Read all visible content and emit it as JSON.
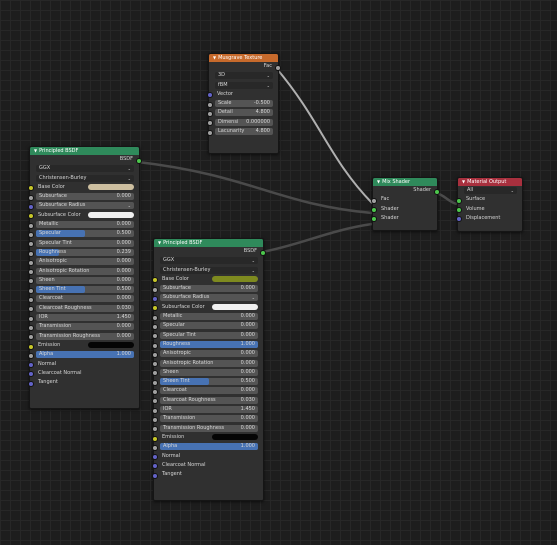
{
  "colors": {
    "shader_header": "#2f8a5b",
    "texture_header": "#c76a2c",
    "output_header": "#a8303e",
    "base_color_left": "#cdbfa0",
    "base_color_right": "#7e8a1f",
    "subsurface_color": "#f0f0f0",
    "emission": "#050505"
  },
  "musgrave": {
    "title": "Musgrave Texture",
    "out_fac": "Fac",
    "dim_mode": "3D",
    "type": "fBM",
    "vector": "Vector",
    "fields": [
      {
        "label": "Scale",
        "value": "-0.500"
      },
      {
        "label": "Detail",
        "value": "4.800"
      },
      {
        "label": "Dimensi",
        "value": "0.000000"
      },
      {
        "label": "Lacunarity",
        "value": "4.800"
      }
    ]
  },
  "principled_left": {
    "title": "Principled BSDF",
    "out": "BSDF",
    "distribution": "GGX",
    "subsurface_method": "Christensen-Burley",
    "base_color": "Base Color",
    "subsurface": {
      "label": "Subsurface",
      "value": "0.000"
    },
    "subsurface_radius": "Subsurface Radius",
    "subsurface_color": "Subsurface Color",
    "params": [
      {
        "label": "Metallic",
        "value": "0.000"
      },
      {
        "label": "Specular",
        "value": "0.500",
        "fill": 0.5
      },
      {
        "label": "Specular Tint",
        "value": "0.000"
      },
      {
        "label": "Roughness",
        "value": "0.239",
        "fill": 0.239
      },
      {
        "label": "Anisotropic",
        "value": "0.000"
      },
      {
        "label": "Anisotropic Rotation",
        "value": "0.000"
      },
      {
        "label": "Sheen",
        "value": "0.000"
      },
      {
        "label": "Sheen Tint",
        "value": "0.500",
        "fill": 0.5
      },
      {
        "label": "Clearcoat",
        "value": "0.000"
      },
      {
        "label": "Clearcoat Roughness",
        "value": "0.030"
      },
      {
        "label": "IOR",
        "value": "1.450"
      },
      {
        "label": "Transmission",
        "value": "0.000"
      },
      {
        "label": "Transmission Roughness",
        "value": "0.000"
      }
    ],
    "emission": "Emission",
    "alpha": {
      "label": "Alpha",
      "value": "1.000",
      "fill": 1.0
    },
    "normal": "Normal",
    "clearcoat_normal": "Clearcoat Normal",
    "tangent": "Tangent"
  },
  "principled_right": {
    "title": "Principled BSDF",
    "out": "BSDF",
    "distribution": "GGX",
    "subsurface_method": "Christensen-Burley",
    "base_color": "Base Color",
    "subsurface": {
      "label": "Subsurface",
      "value": "0.000"
    },
    "subsurface_radius": "Subsurface Radius",
    "subsurface_color": "Subsurface Color",
    "params": [
      {
        "label": "Metallic",
        "value": "0.000"
      },
      {
        "label": "Specular",
        "value": "0.000"
      },
      {
        "label": "Specular Tint",
        "value": "0.000"
      },
      {
        "label": "Roughness",
        "value": "1.000",
        "fill": 1.0
      },
      {
        "label": "Anisotropic",
        "value": "0.000"
      },
      {
        "label": "Anisotropic Rotation",
        "value": "0.000"
      },
      {
        "label": "Sheen",
        "value": "0.000"
      },
      {
        "label": "Sheen Tint",
        "value": "0.500",
        "fill": 0.5
      },
      {
        "label": "Clearcoat",
        "value": "0.000"
      },
      {
        "label": "Clearcoat Roughness",
        "value": "0.030"
      },
      {
        "label": "IOR",
        "value": "1.450"
      },
      {
        "label": "Transmission",
        "value": "0.000"
      },
      {
        "label": "Transmission Roughness",
        "value": "0.000"
      }
    ],
    "emission": "Emission",
    "alpha": {
      "label": "Alpha",
      "value": "1.000",
      "fill": 1.0
    },
    "normal": "Normal",
    "clearcoat_normal": "Clearcoat Normal",
    "tangent": "Tangent"
  },
  "mix": {
    "title": "Mix Shader",
    "out": "Shader",
    "inputs": [
      "Fac",
      "Shader",
      "Shader"
    ]
  },
  "output": {
    "title": "Material Output",
    "target": "All",
    "inputs": [
      "Surface",
      "Volume",
      "Displacement"
    ]
  }
}
